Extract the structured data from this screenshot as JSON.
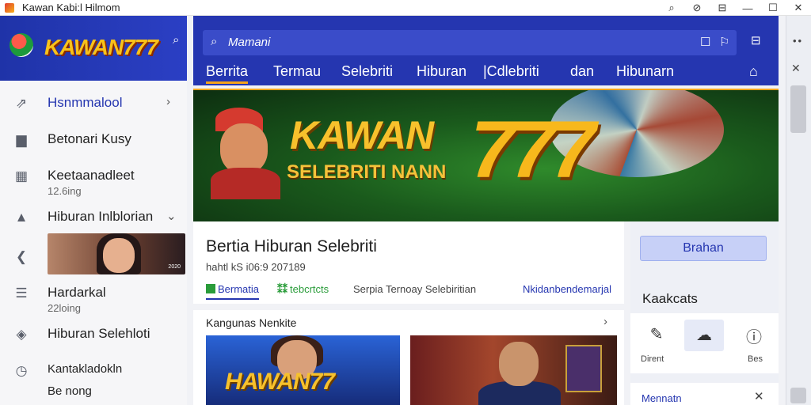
{
  "window": {
    "title": "Kawan Kabi:l Hilmom",
    "controls": [
      "⌕",
      "⊘",
      "⊟",
      "—",
      "☐",
      "✕"
    ]
  },
  "sidebar": {
    "logo": "KAWAN777",
    "items": [
      {
        "label": "Hsnmmalool",
        "icon": "trending-icon",
        "chevron": "›"
      },
      {
        "label": "Betonari Kusy",
        "icon": "folder-icon"
      },
      {
        "label": "Keetaanadleet",
        "sub": "12.6ing",
        "icon": "grid-icon"
      },
      {
        "label": "Hiburan Inlblorian",
        "icon": "alert-icon",
        "chevron": "⌄"
      },
      {
        "label": "",
        "icon": "arrow-left-icon",
        "thumb_caption": "2020"
      },
      {
        "label": "Hardarkal",
        "sub": "22loing",
        "icon": "list-icon"
      },
      {
        "label": "Hiburan Selehloti",
        "icon": "compass-icon"
      },
      {
        "label": "Kantakladokln",
        "sub": "Be nong",
        "icon": "timer-icon"
      }
    ]
  },
  "topbar": {
    "search_placeholder": "Mamani",
    "tabs": [
      "Berrita",
      "Termau",
      "Selebriti",
      "Hiburan",
      "|Cdlebriti",
      "dan",
      "Hibunarn"
    ]
  },
  "banner": {
    "title": "KAWAN",
    "subtitle": "SELEBRITI NANN",
    "number": "777"
  },
  "article": {
    "title": "Bertia Hiburan Selebriti",
    "meta": "hahtl kS i06:9 207189",
    "tags": [
      "Bermatia",
      "tebcrtcts",
      "Serpia Ternoay Selebiritian",
      "Nkidanbendemarjal"
    ]
  },
  "rightpanel": {
    "button": "Brahan",
    "heading": "Kaakcats",
    "icons": [
      {
        "name": "edit-icon",
        "cap": "Dirent"
      },
      {
        "name": "chat-icon",
        "cap": ""
      },
      {
        "name": "info-icon",
        "cap": "Bes"
      }
    ],
    "bottom_label": "Mennatn"
  },
  "cards": {
    "heading": "Kangunas Nenkite",
    "items": [
      {
        "title": "HAWAN77"
      },
      {
        "title": ""
      }
    ]
  }
}
